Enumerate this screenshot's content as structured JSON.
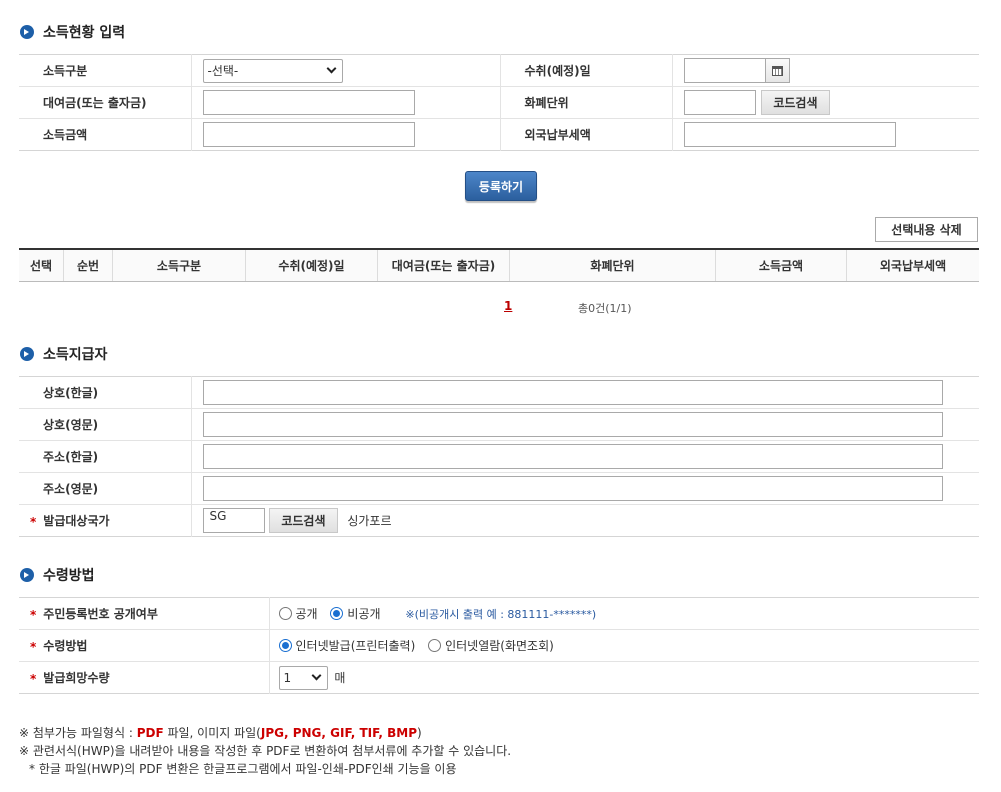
{
  "income_section": {
    "title": "소득현황 입력",
    "labels": {
      "income_type": "소득구분",
      "receipt_date": "수취(예정)일",
      "loan_amount": "대여금(또는 출자금)",
      "currency": "화폐단위",
      "income_amount": "소득금액",
      "foreign_tax": "외국납부세액"
    },
    "income_type_value": "-선택-",
    "receipt_date_value": "",
    "loan_amount_value": "",
    "currency_value": "",
    "income_amount_value": "",
    "foreign_tax_value": "",
    "code_search_label": "코드검색",
    "register_label": "등록하기",
    "delete_selected_label": "선택내용 삭제"
  },
  "list": {
    "columns": [
      "선택",
      "순번",
      "소득구분",
      "수취(예정)일",
      "대여금(또는 출자금)",
      "화폐단위",
      "소득금액",
      "외국납부세액"
    ],
    "page": "1",
    "total": "총0건(1/1)"
  },
  "payer_section": {
    "title": "소득지급자",
    "labels": {
      "name_kr": "상호(한글)",
      "name_en": "상호(영문)",
      "addr_kr": "주소(한글)",
      "addr_en": "주소(영문)",
      "country": "발급대상국가"
    },
    "name_kr_value": "",
    "name_en_value": "",
    "addr_kr_value": "",
    "addr_en_value": "",
    "country_code_value": "SG",
    "code_search_label": "코드검색",
    "country_name": "싱가포르"
  },
  "receive_section": {
    "title": "수령방법",
    "labels": {
      "rrn_disclosure": "주민등록번호 공개여부",
      "method": "수령방법",
      "quantity": "발급희망수량"
    },
    "rrn_options": [
      "공개",
      "비공개"
    ],
    "rrn_selected": "비공개",
    "rrn_note": "※(비공개시 출력 예 : 881111-*******)",
    "method_options": [
      "인터넷발급(프린터출력)",
      "인터넷열람(화면조회)"
    ],
    "method_selected": "인터넷발급(프린터출력)",
    "quantity_value": "1",
    "quantity_unit": "매",
    "required_mark": "*"
  },
  "notes": {
    "line1_prefix": "※ 첨부가능 파일형식 : ",
    "line1_pdf": "PDF",
    "line1_mid": " 파일, 이미지 파일(",
    "line1_imgs": "JPG, PNG, GIF, TIF, BMP",
    "line1_suffix": ")",
    "line2": "※ 관련서식(HWP)을 내려받아 내용을 작성한 후 PDF로 변환하여 첨부서류에 추가할 수 있습니다.",
    "line3": "* 한글 파일(HWP)의 PDF 변환은 한글프로그램에서 파일-인쇄-PDF인쇄 기능을 이용"
  }
}
